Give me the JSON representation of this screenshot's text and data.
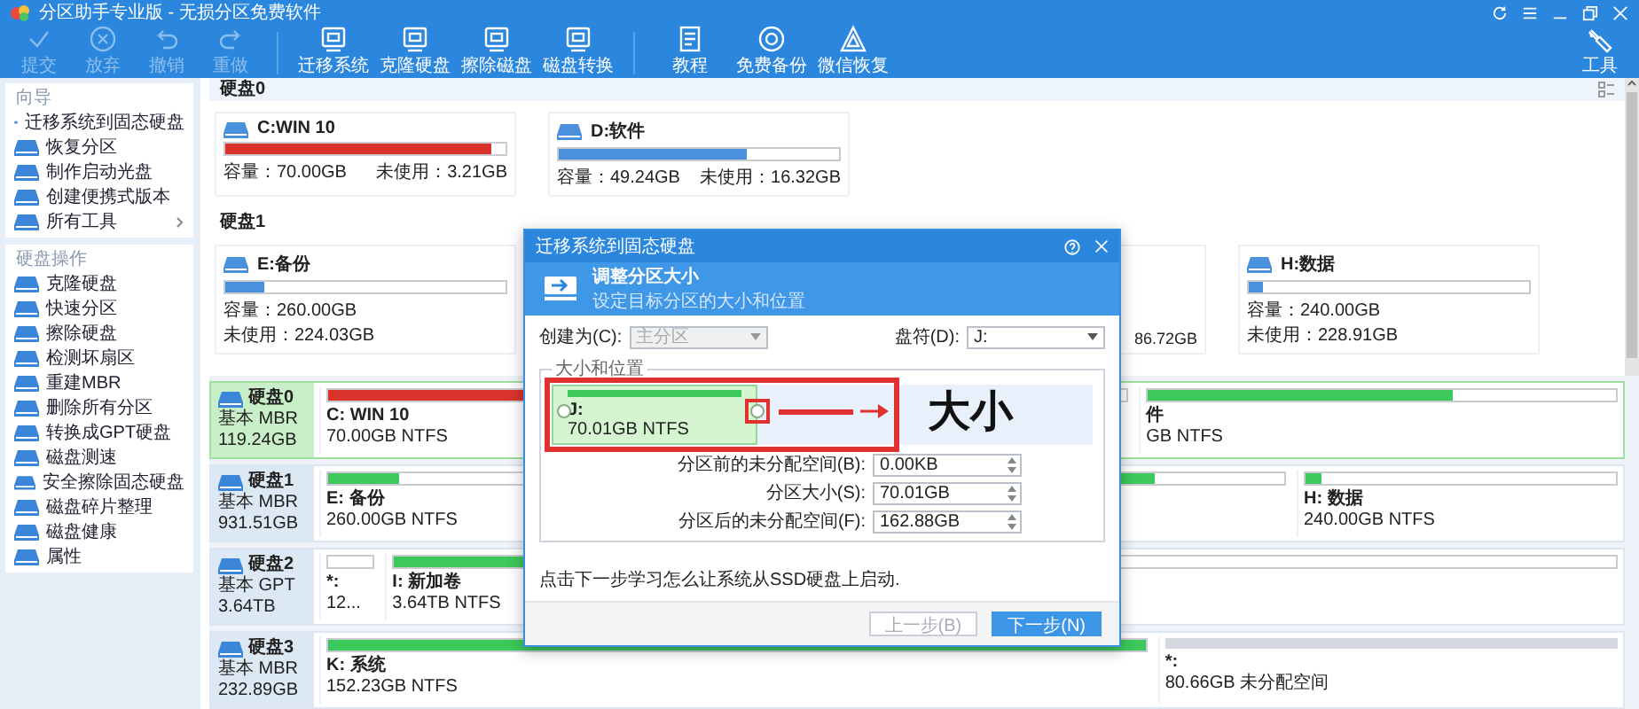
{
  "window": {
    "title": "分区助手专业版 - 无损分区免费软件"
  },
  "toolbar": [
    {
      "label": "提交",
      "disabled": true
    },
    {
      "label": "放弃",
      "disabled": true
    },
    {
      "label": "撤销",
      "disabled": true
    },
    {
      "label": "重做",
      "disabled": true
    },
    {
      "label": "迁移系统",
      "disabled": false
    },
    {
      "label": "克隆硬盘",
      "disabled": false
    },
    {
      "label": "擦除磁盘",
      "disabled": false
    },
    {
      "label": "磁盘转换",
      "disabled": false
    },
    {
      "label": "教程",
      "disabled": false
    },
    {
      "label": "免费备份",
      "disabled": false
    },
    {
      "label": "微信恢复",
      "disabled": false
    }
  ],
  "tools_button": "工具",
  "sidebar": [
    {
      "title": "向导",
      "items": [
        {
          "label": "迁移系统到固态硬盘",
          "submenu": false
        },
        {
          "label": "恢复分区",
          "submenu": false
        },
        {
          "label": "制作启动光盘",
          "submenu": false
        },
        {
          "label": "创建便携式版本",
          "submenu": false
        },
        {
          "label": "所有工具",
          "submenu": true
        }
      ]
    },
    {
      "title": "硬盘操作",
      "items": [
        {
          "label": "克隆硬盘",
          "submenu": false
        },
        {
          "label": "快速分区",
          "submenu": false
        },
        {
          "label": "擦除硬盘",
          "submenu": false
        },
        {
          "label": "检测坏扇区",
          "submenu": false
        },
        {
          "label": "重建MBR",
          "submenu": false
        },
        {
          "label": "删除所有分区",
          "submenu": false
        },
        {
          "label": "转换成GPT硬盘",
          "submenu": false
        },
        {
          "label": "磁盘测速",
          "submenu": false
        },
        {
          "label": "安全擦除固态硬盘",
          "submenu": false
        },
        {
          "label": "磁盘碎片整理",
          "submenu": false
        },
        {
          "label": "磁盘健康",
          "submenu": false
        },
        {
          "label": "属性",
          "submenu": false
        }
      ]
    }
  ],
  "overview": [
    {
      "title": "硬盘0",
      "cards": [
        {
          "kind": "card",
          "name": "C:WIN 10",
          "level": 0.95,
          "color": "#d9342b",
          "capacity": "容量：70.00GB",
          "free": "未使用：3.21GB"
        },
        {
          "kind": "card",
          "name": "D:软件",
          "level": 0.67,
          "color": "#4a90dc",
          "capacity": "容量：49.24GB",
          "free": "未使用：16.32GB"
        }
      ]
    },
    {
      "title": "硬盘1",
      "cards": [
        {
          "kind": "card",
          "name": "E:备份",
          "level": 0.14,
          "color": "#4a90dc",
          "capacity": "容量：260.00GB",
          "free": "未使用：224.03GB"
        },
        {
          "kind": "partial",
          "free": "86.72GB"
        },
        {
          "kind": "card",
          "name": "H:数据",
          "level": 0.05,
          "color": "#4a90dc",
          "capacity": "容量：240.00GB",
          "free": "未使用：228.91GB"
        }
      ]
    }
  ],
  "disk_map": [
    {
      "name": "硬盘0",
      "style": "基本 MBR",
      "size": "119.24GB",
      "selected": true,
      "partitions": [
        {
          "kind": "partition",
          "label": "C: WIN 10",
          "detail": "70.00GB NTFS",
          "level": 0.95,
          "color": "#d9342b"
        },
        {
          "kind": "partition",
          "label": "件",
          "detail": "GB NTFS",
          "level": 0.65,
          "color": "#3cc85a"
        }
      ]
    },
    {
      "name": "硬盘1",
      "style": "基本 MBR",
      "size": "931.51GB",
      "selected": false,
      "partitions": [
        {
          "kind": "partition",
          "label": "E: 备份",
          "detail": "260.00GB NTFS",
          "level": 0.14,
          "color": "#3cc85a"
        },
        {
          "kind": "partition",
          "level": 0.7,
          "color": "#3cc85a"
        },
        {
          "kind": "partition",
          "label": "H: 数据",
          "detail": "240.00GB NTFS",
          "level": 0.05,
          "color": "#3cc85a"
        }
      ]
    },
    {
      "name": "硬盘2",
      "style": "基本 GPT",
      "size": "3.64TB",
      "selected": false,
      "partitions": [
        {
          "kind": "empty",
          "label": "*:",
          "detail": "12..."
        },
        {
          "kind": "partition",
          "label": "I: 新加卷",
          "detail": "3.64TB NTFS",
          "level": 0.55,
          "color": "#3cc85a"
        }
      ]
    },
    {
      "name": "硬盘3",
      "style": "基本 MBR",
      "size": "232.89GB",
      "selected": false,
      "partitions": [
        {
          "kind": "partition",
          "label": "K: 系统",
          "detail": "152.23GB NTFS",
          "level": 1,
          "color": "#3cc85a"
        },
        {
          "kind": "unallocated",
          "label": "*:",
          "detail": "80.66GB 未分配空间"
        }
      ]
    }
  ],
  "dialog": {
    "title": "迁移系统到固态硬盘",
    "heading": "调整分区大小",
    "subheading": "设定目标分区的大小和位置",
    "create_as": {
      "label": "创建为(C):",
      "value": "主分区",
      "disabled": true
    },
    "drive_letter": {
      "label": "盘符(D):",
      "value": "J:"
    },
    "group_label": "大小和位置",
    "partition": {
      "label": "J:",
      "detail": "70.01GB NTFS"
    },
    "annotation": "大小",
    "fields": [
      {
        "label": "分区前的未分配空间(B):",
        "value": "0.00KB"
      },
      {
        "label": "分区大小(S):",
        "value": "70.01GB"
      },
      {
        "label": "分区后的未分配空间(F):",
        "value": "162.88GB"
      }
    ],
    "note": "点击下一步学习怎么让系统从SSD硬盘上启动.",
    "buttons": [
      {
        "label": "上一步(B)",
        "kind": "secondary",
        "disabled": true
      },
      {
        "label": "下一步(N)",
        "kind": "primary",
        "disabled": false
      }
    ]
  }
}
